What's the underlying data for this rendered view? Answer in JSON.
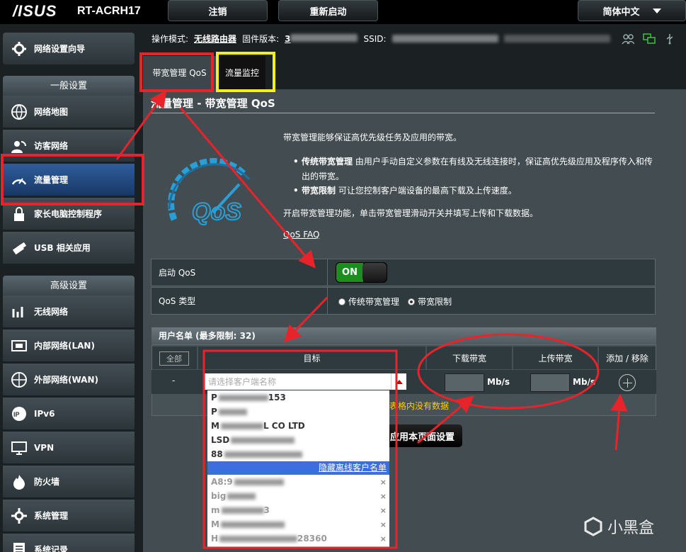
{
  "header": {
    "logo": "/ISUS",
    "model": "RT-ACRH17",
    "logout": "注销",
    "reboot": "重新启动",
    "language": "简体中文"
  },
  "status": {
    "op_mode_label": "操作模式:",
    "op_mode_value": "无线路由器",
    "fw_label": "固件版本:",
    "fw_value": "3",
    "ssid_label": "SSID:"
  },
  "sidebar": {
    "wizard": "网络设置向导",
    "general_header": "一般设置",
    "general": [
      {
        "label": "网络地图",
        "icon": "globe-icon"
      },
      {
        "label": "访客网络",
        "icon": "guest-network-icon"
      },
      {
        "label": "流量管理",
        "icon": "gauge-icon"
      },
      {
        "label": "家长电脑控制程序",
        "icon": "parental-lock-icon"
      },
      {
        "label": "USB 相关应用",
        "icon": "usb-icon"
      }
    ],
    "advanced_header": "高级设置",
    "advanced": [
      {
        "label": "无线网络",
        "icon": "wifi-icon"
      },
      {
        "label": "内部网络(LAN)",
        "icon": "lan-icon"
      },
      {
        "label": "外部网络(WAN)",
        "icon": "wan-globe-icon"
      },
      {
        "label": "IPv6",
        "icon": "ipv6-icon"
      },
      {
        "label": "VPN",
        "icon": "vpn-icon"
      },
      {
        "label": "防火墙",
        "icon": "firewall-icon"
      },
      {
        "label": "系统管理",
        "icon": "admin-gear-icon"
      },
      {
        "label": "系统记录",
        "icon": "log-icon"
      }
    ]
  },
  "tabs": [
    {
      "label": "带宽管理 QoS"
    },
    {
      "label": "流量监控"
    }
  ],
  "page": {
    "title": "流量管理 - 带宽管理 QoS",
    "intro": "带宽管理能够保证高优先级任务及应用的带宽。",
    "bullet1_title": "传统带宽管理",
    "bullet1_text": " 由用户手动自定义参数在有线及无线连接时，保证高优先级应用及程序传入和传出的带宽。",
    "bullet2_title": "带宽限制",
    "bullet2_text": " 可让您控制客户端设备的最高下载及上传速度。",
    "enable_text": "开启带宽管理功能，单击带宽管理滑动开关并填写上传和下载数据。",
    "faq": "QoS FAQ",
    "logo_text": "QoS"
  },
  "settings": {
    "enable_label": "启动 QoS",
    "toggle": "ON",
    "type_label": "QoS 类型",
    "type_options": [
      "传统带宽管理",
      "带宽限制"
    ],
    "type_selected": "带宽限制"
  },
  "table": {
    "header": "用户名单 (最多限制: 32)",
    "all_button": "全部",
    "columns": [
      "目标",
      "下载带宽",
      "上传带宽",
      "添加 / 移除"
    ],
    "row_dash": "-",
    "select_placeholder": "请选择客户端名称",
    "unit": "Mb/s",
    "nodata": "表格内没有数据",
    "apply": "应用本页面设置"
  },
  "dropdown": {
    "online": [
      "P",
      "P",
      "M",
      "LSD",
      "88"
    ],
    "online_suffix": [
      "153",
      "",
      "L CO LTD",
      "",
      ""
    ],
    "hide_offline": "隐藏离线客户名单",
    "offline": [
      "A8:9",
      "big",
      "m",
      "M",
      "H"
    ],
    "offline_suffix": [
      "",
      "",
      "3",
      "",
      "28360"
    ],
    "remove_glyph": "×"
  },
  "watermark": "小黑盒",
  "colors": {
    "highlight_red": "#e8232a",
    "highlight_yellow": "#f5f01c",
    "active_blue": "#2f5d9c",
    "on_green": "#1a8f20"
  }
}
